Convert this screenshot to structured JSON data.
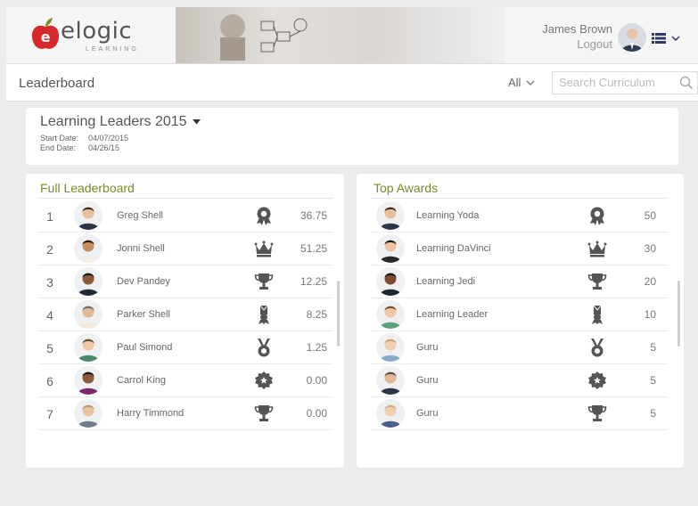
{
  "brand": {
    "logo_text": "elogic",
    "logo_sub": "LEARNING"
  },
  "header": {
    "user_name": "James Brown",
    "logout": "Logout"
  },
  "page": {
    "title": "Leaderboard",
    "filter_value": "All",
    "search_placeholder": "Search Curriculum"
  },
  "contest": {
    "title": "Learning Leaders 2015",
    "start_label": "Start Date:",
    "start_value": "04/07/2015",
    "end_label": "End Date:",
    "end_value": "04/26/15"
  },
  "full_leaderboard": {
    "title": "Full Leaderboard",
    "rows": [
      {
        "rank": "1",
        "name": "Greg Shell",
        "badge": "rosette-icon",
        "score": "36.75"
      },
      {
        "rank": "2",
        "name": "Jonni Shell",
        "badge": "crown-icon",
        "score": "51.25"
      },
      {
        "rank": "3",
        "name": "Dev Pandey",
        "badge": "trophy-icon",
        "score": "12.25"
      },
      {
        "rank": "4",
        "name": "Parker Shell",
        "badge": "ribbon-icon",
        "score": "8.25"
      },
      {
        "rank": "5",
        "name": "Paul Simond",
        "badge": "medal-icon",
        "score": "1.25"
      },
      {
        "rank": "6",
        "name": "Carrol King",
        "badge": "seal-icon",
        "score": "0.00"
      },
      {
        "rank": "7",
        "name": "Harry Timmond",
        "badge": "trophy-icon",
        "score": "0.00"
      }
    ]
  },
  "top_awards": {
    "title": "Top Awards",
    "rows": [
      {
        "name": "Learning Yoda",
        "badge": "rosette-icon",
        "score": "50"
      },
      {
        "name": "Learning DaVinci",
        "badge": "crown-icon",
        "score": "30"
      },
      {
        "name": "Learning Jedi",
        "badge": "trophy-icon",
        "score": "20"
      },
      {
        "name": "Learning Leader",
        "badge": "ribbon-icon",
        "score": "10"
      },
      {
        "name": "Guru",
        "badge": "medal-icon",
        "score": "5"
      },
      {
        "name": "Guru",
        "badge": "seal-icon",
        "score": "5"
      },
      {
        "name": "Guru",
        "badge": "trophy-icon",
        "score": "5"
      }
    ]
  },
  "colors": {
    "accent": "#7a8a2c",
    "logo_red": "#d62a2a",
    "icon": "#555555"
  }
}
